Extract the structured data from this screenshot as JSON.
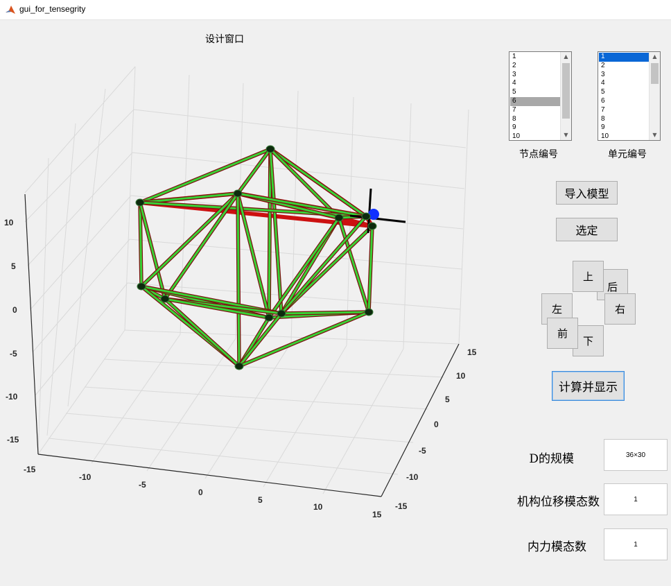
{
  "window": {
    "title": "gui_for_tensegrity"
  },
  "plot": {
    "title": "设计窗口",
    "z_ticks": [
      "10",
      "5",
      "0",
      "-5",
      "-10",
      "-15"
    ],
    "x_ticks": [
      "-15",
      "-10",
      "-5",
      "0",
      "5",
      "10",
      "15"
    ],
    "y_ticks": [
      "15",
      "10",
      "5",
      "0",
      "-5",
      "-10",
      "-15"
    ],
    "colors": {
      "bar": "#39d236",
      "cable": "#cc1010",
      "node": "#0d2a0d",
      "highlight": "#1030ff"
    }
  },
  "node_list": {
    "label": "节点编号",
    "items": [
      "1",
      "2",
      "3",
      "4",
      "5",
      "6",
      "7",
      "8",
      "9",
      "10"
    ],
    "selected": "6"
  },
  "element_list": {
    "label": "单元编号",
    "items": [
      "1",
      "2",
      "3",
      "4",
      "5",
      "6",
      "7",
      "8",
      "9",
      "10"
    ],
    "selected": "1"
  },
  "buttons": {
    "import": "导入模型",
    "select": "选定",
    "up": "上",
    "back": "后",
    "left": "左",
    "right": "右",
    "front": "前",
    "down": "下",
    "compute": "计算并显示"
  },
  "params": {
    "d_size_label": "D的规模",
    "d_size_value": "36×30",
    "mech_modes_label": "机构位移模态数",
    "mech_modes_value": "1",
    "force_modes_label": "内力模态数",
    "force_modes_value": "1"
  }
}
